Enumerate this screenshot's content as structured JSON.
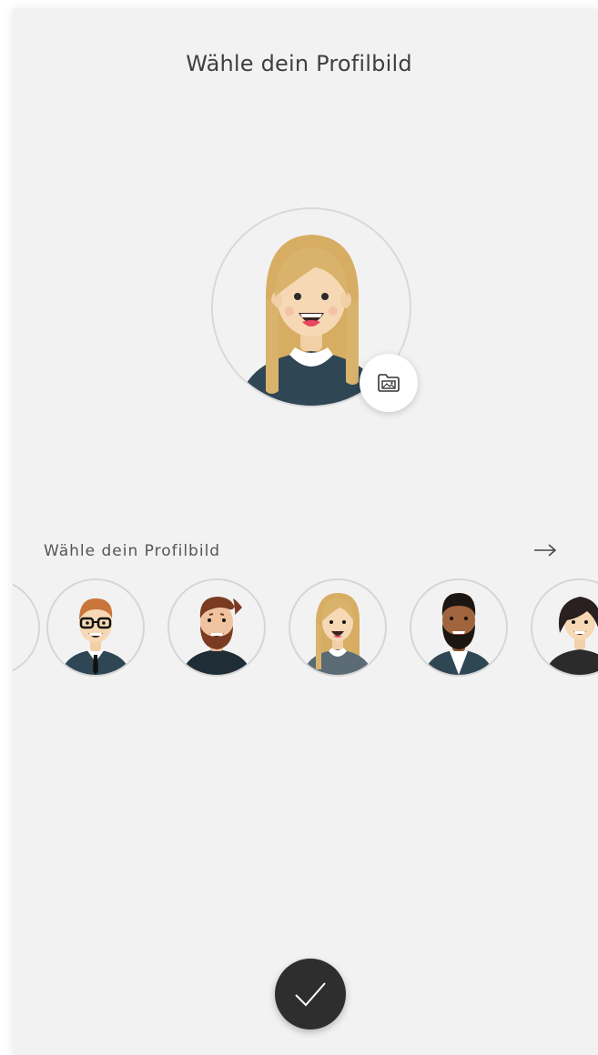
{
  "header": {
    "title": "Wähle dein Profilbild"
  },
  "main_avatar": {
    "icon": "woman-blonde-avatar"
  },
  "upload_button": {
    "icon": "photo-folder-icon"
  },
  "avatar_picker": {
    "label": "Wähle dein Profilbild",
    "next_icon": "arrow-right-icon",
    "options": [
      {
        "icon": "partial-avatar-left"
      },
      {
        "icon": "man-glasses-tie-avatar"
      },
      {
        "icon": "man-beard-avatar"
      },
      {
        "icon": "woman-blonde-avatar"
      },
      {
        "icon": "man-dark-skin-beard-avatar"
      },
      {
        "icon": "woman-dark-hair-avatar"
      }
    ]
  },
  "confirm_button": {
    "icon": "checkmark-icon"
  },
  "colors": {
    "background": "#f2f2f2",
    "title": "#3f3f3f",
    "confirm_bg": "#2e2e2e",
    "shirt_navy": "#2f4654",
    "hair_blonde": "#d9b36b",
    "skin_light": "#f6d8b4"
  }
}
